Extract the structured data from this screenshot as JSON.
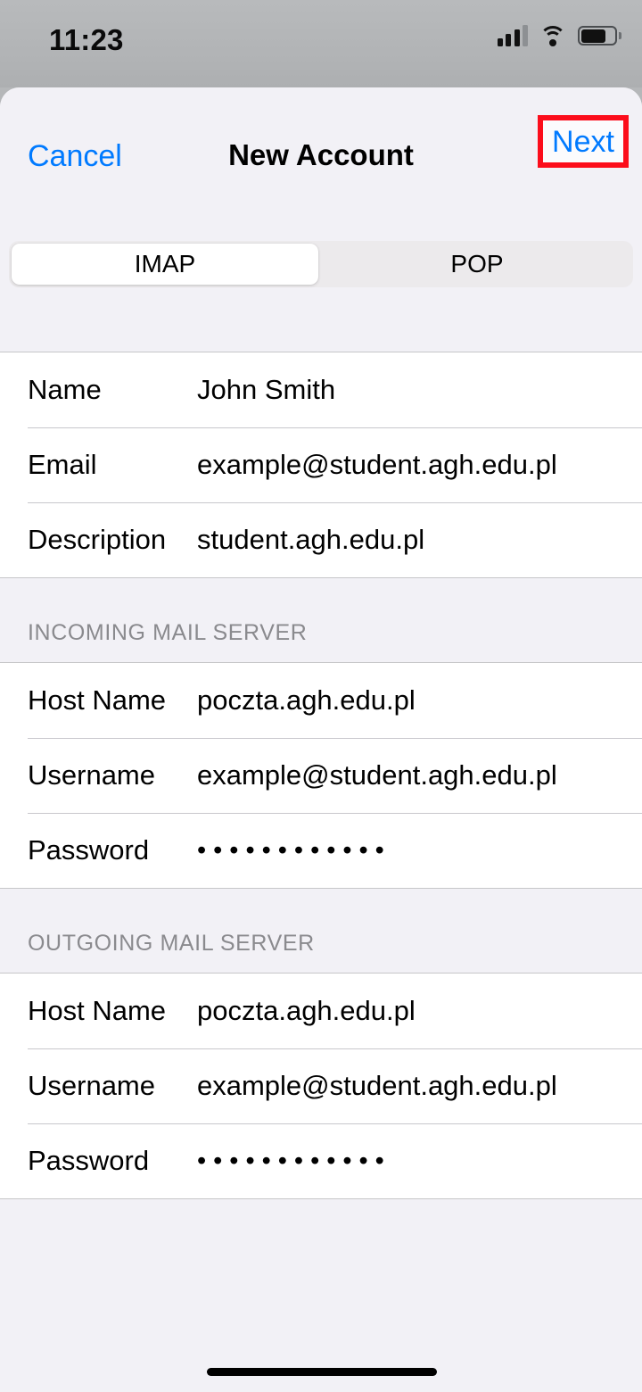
{
  "status_bar": {
    "time": "11:23",
    "cellular_icon": "cellular-signal-icon",
    "cellular_bars_filled": 3,
    "cellular_bars_total": 4,
    "wifi_icon": "wifi-icon",
    "battery_icon": "battery-icon",
    "battery_level_percent": 70
  },
  "nav_bar": {
    "cancel_label": "Cancel",
    "title": "New Account",
    "next_label": "Next",
    "highlight_color": "#fc0d1b",
    "accent_color": "#007aff"
  },
  "segmented_control": {
    "options": [
      {
        "label": "IMAP",
        "selected": true
      },
      {
        "label": "POP",
        "selected": false
      }
    ],
    "selected": "IMAP"
  },
  "sections": [
    {
      "header": "",
      "rows": [
        {
          "label": "Name",
          "value": "John Smith",
          "type": "text"
        },
        {
          "label": "Email",
          "value": "example@student.agh.edu.pl",
          "type": "email"
        },
        {
          "label": "Description",
          "value": "student.agh.edu.pl",
          "type": "text"
        }
      ]
    },
    {
      "header": "INCOMING MAIL SERVER",
      "rows": [
        {
          "label": "Host Name",
          "value": "poczta.agh.edu.pl",
          "type": "text"
        },
        {
          "label": "Username",
          "value": "example@student.agh.edu.pl",
          "type": "text"
        },
        {
          "label": "Password",
          "value": "••••••••••••",
          "type": "password"
        }
      ]
    },
    {
      "header": "OUTGOING MAIL SERVER",
      "rows": [
        {
          "label": "Host Name",
          "value": "poczta.agh.edu.pl",
          "type": "text"
        },
        {
          "label": "Username",
          "value": "example@student.agh.edu.pl",
          "type": "text"
        },
        {
          "label": "Password",
          "value": "••••••••••••",
          "type": "password"
        }
      ]
    }
  ],
  "home_indicator": "home-indicator"
}
